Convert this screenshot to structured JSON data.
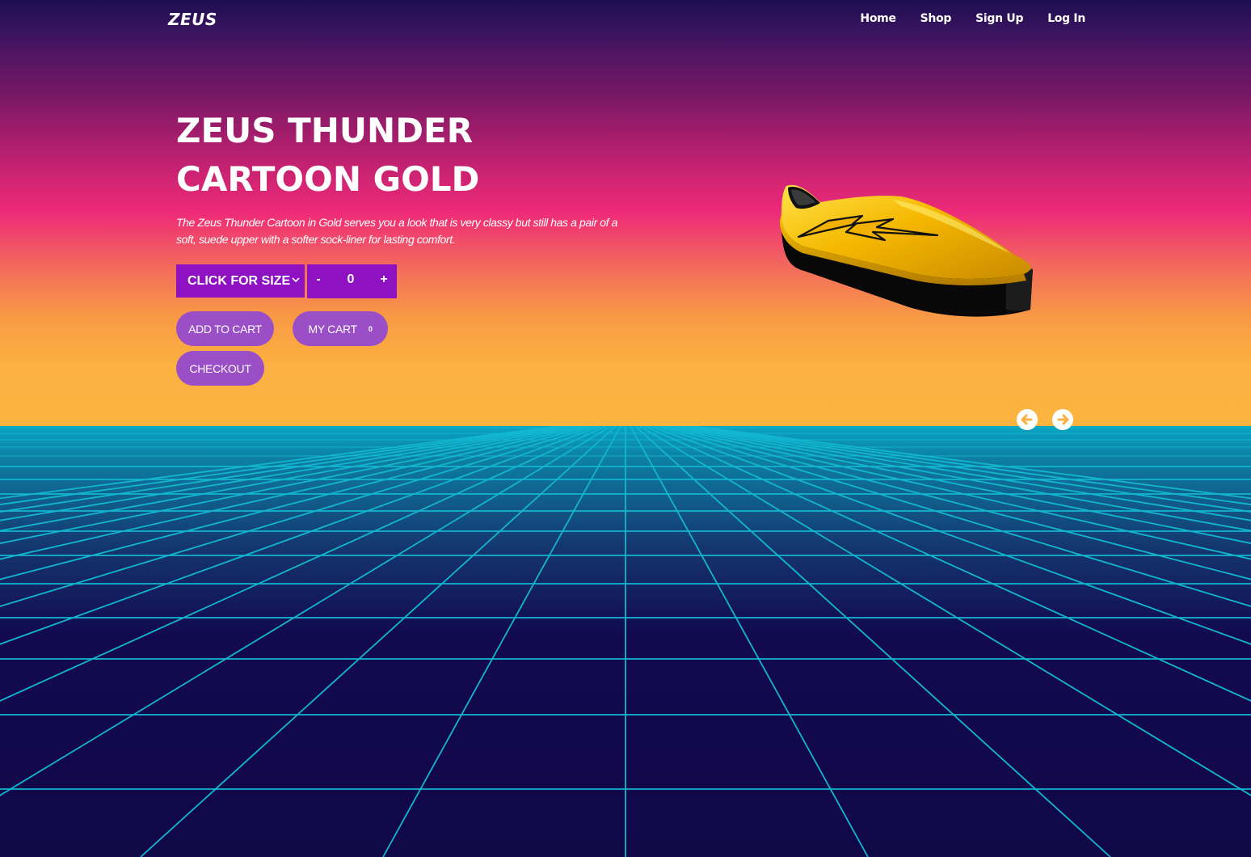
{
  "nav": {
    "logo": "ZEUS",
    "links": [
      "Home",
      "Shop",
      "Sign Up",
      "Log In"
    ]
  },
  "product": {
    "title": "ZEUS THUNDER CARTOON GOLD",
    "description": "The Zeus Thunder Cartoon in Gold serves you a look that is very classy but still has a pair of a soft, suede upper with a softer sock-liner for lasting comfort.",
    "size_select": "CLICK FOR SIZE",
    "quantity": {
      "minus": "-",
      "value": "0",
      "plus": "+"
    }
  },
  "actions": {
    "add_to_cart": "ADD TO CART",
    "my_cart": "MY CART",
    "cart_count": "0",
    "checkout": "CHECKOUT"
  },
  "carousel": {
    "prev_icon": "arrow-left-circle-icon",
    "next_icon": "arrow-right-circle-icon"
  },
  "colors": {
    "button_purple": "#8e11c2",
    "pill_purple": "#9a4fc7",
    "grid_line": "#12b6cf",
    "shoe_gold": "#f5b800"
  }
}
